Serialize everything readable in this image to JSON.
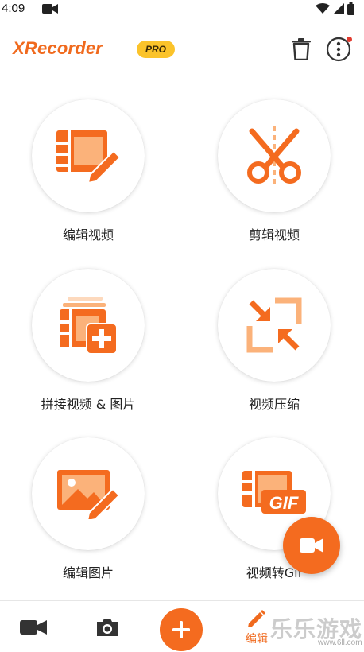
{
  "status_bar": {
    "time": "4:09"
  },
  "header": {
    "brand": "XRecorder",
    "badge": "PRO"
  },
  "features": [
    {
      "label": "编辑视频",
      "icon": "film-edit-icon"
    },
    {
      "label": "剪辑视频",
      "icon": "scissors-icon"
    },
    {
      "label": "拼接视频 & 图片",
      "icon": "film-merge-icon"
    },
    {
      "label": "视频压缩",
      "icon": "compress-icon"
    },
    {
      "label": "编辑图片",
      "icon": "image-edit-icon"
    },
    {
      "label": "视频转Gif",
      "icon": "gif-icon"
    }
  ],
  "bottom_nav": {
    "edit_label": "编辑"
  },
  "watermark": {
    "text": "乐乐游戏",
    "sub": "www.6ll.com"
  },
  "colors": {
    "accent": "#f46b1f",
    "accent_light": "#fbb27a",
    "pro_badge": "#fbc32a"
  }
}
